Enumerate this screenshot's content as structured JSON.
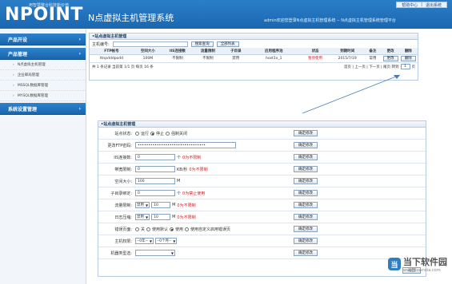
{
  "header": {
    "logo": "NPOINT",
    "logo_sub": "用智慧整合科技新价值",
    "app_title": "N点虚拟主机管理系统",
    "welcome": "admin欢迎您登录N点虚拟主机管理系统 -- N点虚拟主机管理系统管理平台",
    "top_links": [
      "帮助中心",
      "|",
      "退出系统"
    ]
  },
  "sidebar": {
    "groups": [
      {
        "label": "产品开设",
        "chevron": "›"
      },
      {
        "label": "产品管理",
        "chevron": "›"
      },
      {
        "label": "系统设置管理",
        "chevron": "›"
      }
    ],
    "sub_items": [
      "N点虚拟主机管理",
      "企业邮局管理",
      "MSSQL数据库管理",
      "MYSQL数据库管理"
    ],
    "bullet": "›"
  },
  "list_panel": {
    "title": "•站点虚拟主机管理",
    "search_label": "主机编号:",
    "search_value": "",
    "search_btn": "搜索查询",
    "all_btn": "全部列表",
    "columns": [
      "FTP帐号",
      "空间大小",
      "IIS连接数",
      "流量限制",
      "子目录",
      "应用程序池",
      "状态",
      "到期时间",
      "备注",
      "更改",
      "删除"
    ],
    "row": {
      "ftp": "ttnpdddpodd",
      "size": "100M",
      "iis": "不限制",
      "traffic": "不限制",
      "subdir": "禁用",
      "pool": "host1x_1",
      "status": "暂停使用",
      "expire": "2015/7/19",
      "note": "常用",
      "edit_btn": "更改",
      "delete_btn": "删除"
    },
    "pager_left": "共 1 条记录  当前第 1/1 页  每页 16 条",
    "pager_links": "首页 | 上一页 | 下一页 | 尾页  转到",
    "pager_value": "1",
    "pager_unit": "页"
  },
  "form_panel": {
    "title": "•站点虚拟主机管理",
    "confirm_label": "确定修改",
    "back_label": "返回",
    "rows": [
      {
        "label": "站点状态:",
        "type": "radio",
        "options": [
          "运行",
          "停止",
          "强制关闭"
        ],
        "selected": 1
      },
      {
        "label": "更改FTP密码:",
        "type": "password",
        "value": "••••••••••••••••••••••••••••••••",
        "width": 120
      },
      {
        "label": "IIS连接数:",
        "type": "text",
        "value": "0",
        "unit": "个",
        "hint": "0为不限制"
      },
      {
        "label": "带宽限制:",
        "type": "text",
        "value": "0",
        "unit": "KB/秒",
        "hint": "0为不限制"
      },
      {
        "label": "空间大小:",
        "type": "text",
        "value": "100",
        "unit": "M",
        "hint": ""
      },
      {
        "label": "子目录绑定:",
        "type": "text",
        "value": "0",
        "unit": "个",
        "hint": "0为禁止使用"
      },
      {
        "label": "流量限制:",
        "type": "select-text",
        "select": "禁用",
        "value": "10",
        "unit": "M",
        "hint": "0为不限制"
      },
      {
        "label": "日志压缩:",
        "type": "select-text",
        "select": "禁用",
        "value": "10",
        "unit": "M",
        "hint": "0为不限制"
      },
      {
        "label": "错误页面:",
        "type": "radio",
        "options": [
          "关",
          "使用默认",
          "使用",
          "使用自定义启用错误页"
        ],
        "selected": 2
      },
      {
        "label": "主机权限:",
        "type": "select2",
        "options": [
          "--0年--",
          "--0个月--"
        ]
      },
      {
        "label": "机器类型选:",
        "type": "blank"
      }
    ]
  },
  "watermark": {
    "icon": "当",
    "text": "当下软件园",
    "url": "www.downxia.com"
  },
  "colors": {
    "brand": "#1b67b0",
    "accent_red": "#d21d1d",
    "panel_border": "#b9cbe0"
  }
}
